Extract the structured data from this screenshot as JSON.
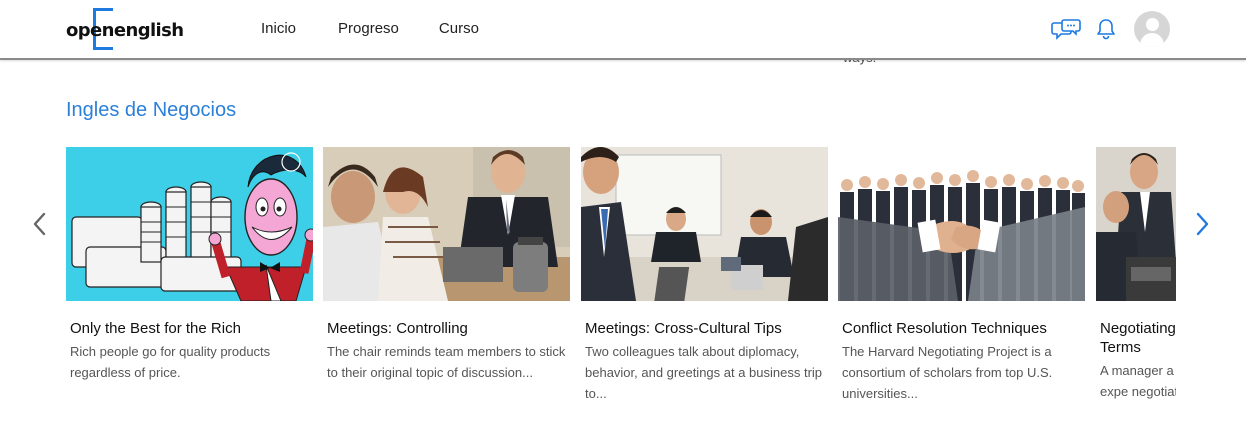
{
  "header": {
    "logo_text": "openenglish",
    "nav": [
      "Inicio",
      "Progreso",
      "Curso"
    ],
    "icons": [
      "chat-icon",
      "bell-icon",
      "avatar"
    ],
    "accent": "#1f7ae0"
  },
  "peek_text": "ways.",
  "section": {
    "title": "Ingles de Negocios"
  },
  "cards": [
    {
      "title": "Only the Best for the Rich",
      "desc": "Rich people go for quality products regardless of price."
    },
    {
      "title": "Meetings: Controlling",
      "desc": "The chair reminds team members to stick to their original topic of discussion..."
    },
    {
      "title": "Meetings: Cross-Cultural Tips",
      "desc": "Two colleagues talk about diplomacy, behavior, and greetings at a business trip to..."
    },
    {
      "title": "Conflict Resolution Techniques",
      "desc": "The Harvard Negotiating Project is a consortium of scholars from top U.S. universities..."
    },
    {
      "title": "Negotiating Key Terms",
      "desc": "A manager a what to expe negotiation.."
    }
  ]
}
